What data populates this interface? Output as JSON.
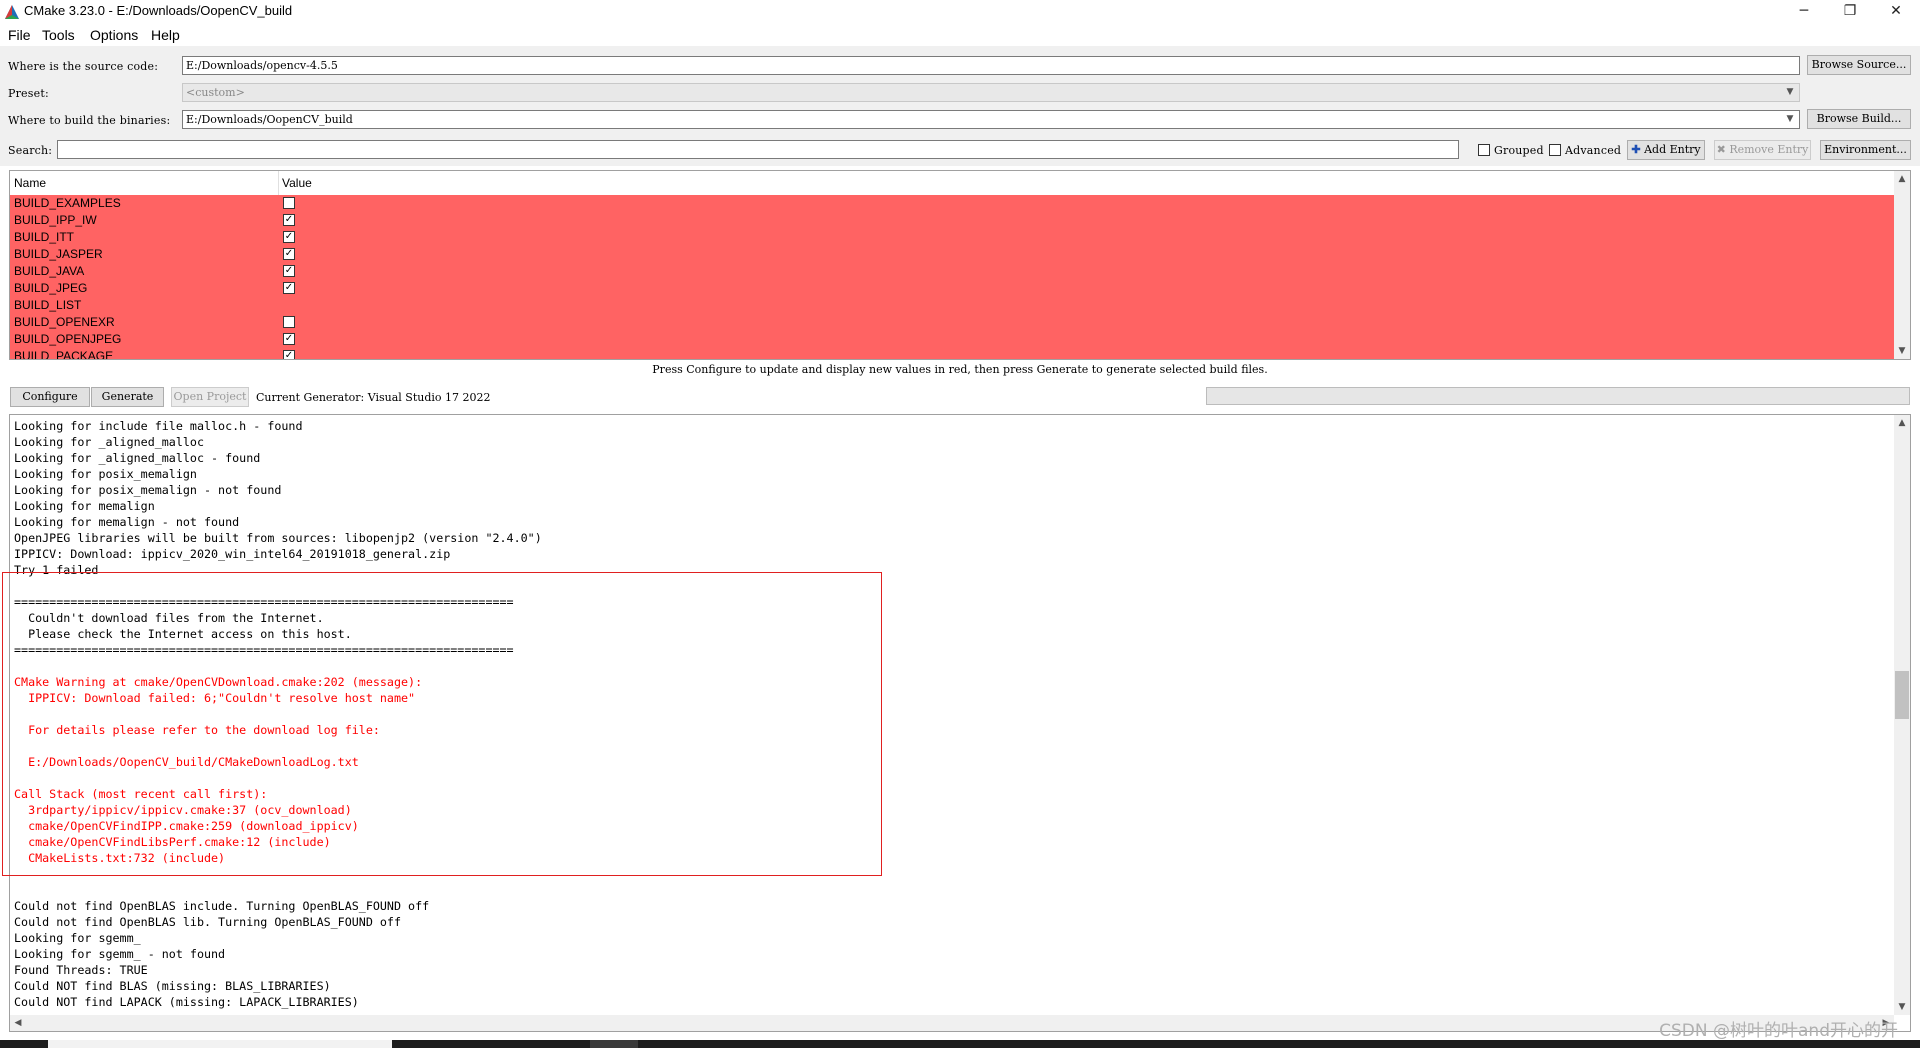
{
  "window": {
    "title": "CMake 3.23.0 - E:/Downloads/OopenCV_build",
    "minimize": "─",
    "restore": "❐",
    "close": "✕"
  },
  "menu": {
    "file": "File",
    "tools": "Tools",
    "options": "Options",
    "help": "Help"
  },
  "form": {
    "source_label": "Where is the source code:",
    "source_value": "E:/Downloads/opencv-4.5.5",
    "browse_source": "Browse Source...",
    "preset_label": "Preset:",
    "preset_value": "<custom>",
    "build_label": "Where to build the binaries:",
    "build_value": "E:/Downloads/OopenCV_build",
    "browse_build": "Browse Build...",
    "search_label": "Search:",
    "search_value": "",
    "grouped": "Grouped",
    "advanced": "Advanced",
    "add_entry": "Add Entry",
    "remove_entry": "Remove Entry",
    "environment": "Environment..."
  },
  "table": {
    "col_name": "Name",
    "col_value": "Value",
    "rows": [
      {
        "name": "BUILD_EXAMPLES",
        "checked": false,
        "has_box": true
      },
      {
        "name": "BUILD_IPP_IW",
        "checked": true,
        "has_box": true
      },
      {
        "name": "BUILD_ITT",
        "checked": true,
        "has_box": true
      },
      {
        "name": "BUILD_JASPER",
        "checked": true,
        "has_box": true
      },
      {
        "name": "BUILD_JAVA",
        "checked": true,
        "has_box": true
      },
      {
        "name": "BUILD_JPEG",
        "checked": true,
        "has_box": true
      },
      {
        "name": "BUILD_LIST",
        "checked": false,
        "has_box": false
      },
      {
        "name": "BUILD_OPENEXR",
        "checked": false,
        "has_box": true
      },
      {
        "name": "BUILD_OPENJPEG",
        "checked": true,
        "has_box": true
      },
      {
        "name": "BUILD_PACKAGE",
        "checked": true,
        "has_box": true
      }
    ],
    "row_color": "#ff6363"
  },
  "hint": "Press Configure to update and display new values in red, then press Generate to generate selected build files.",
  "actions": {
    "configure": "Configure",
    "generate": "Generate",
    "open_project": "Open Project",
    "generator": "Current Generator: Visual Studio 17 2022"
  },
  "log": [
    {
      "text": "Looking for include file malloc.h - found",
      "warn": false
    },
    {
      "text": "Looking for _aligned_malloc",
      "warn": false
    },
    {
      "text": "Looking for _aligned_malloc - found",
      "warn": false
    },
    {
      "text": "Looking for posix_memalign",
      "warn": false
    },
    {
      "text": "Looking for posix_memalign - not found",
      "warn": false
    },
    {
      "text": "Looking for memalign",
      "warn": false
    },
    {
      "text": "Looking for memalign - not found",
      "warn": false
    },
    {
      "text": "OpenJPEG libraries will be built from sources: libopenjp2 (version \"2.4.0\")",
      "warn": false
    },
    {
      "text": "IPPICV: Download: ippicv_2020_win_intel64_20191018_general.zip",
      "warn": false
    },
    {
      "text": "Try 1 failed",
      "warn": false
    },
    {
      "text": "",
      "warn": false
    },
    {
      "text": "=======================================================================",
      "warn": false
    },
    {
      "text": "  Couldn't download files from the Internet.",
      "warn": false
    },
    {
      "text": "  Please check the Internet access on this host.",
      "warn": false
    },
    {
      "text": "=======================================================================",
      "warn": false
    },
    {
      "text": "",
      "warn": false
    },
    {
      "text": "CMake Warning at cmake/OpenCVDownload.cmake:202 (message):",
      "warn": true
    },
    {
      "text": "  IPPICV: Download failed: 6;\"Couldn't resolve host name\"",
      "warn": true
    },
    {
      "text": "",
      "warn": true
    },
    {
      "text": "  For details please refer to the download log file:",
      "warn": true
    },
    {
      "text": "",
      "warn": true
    },
    {
      "text": "  E:/Downloads/OopenCV_build/CMakeDownloadLog.txt",
      "warn": true
    },
    {
      "text": "",
      "warn": true
    },
    {
      "text": "Call Stack (most recent call first):",
      "warn": true
    },
    {
      "text": "  3rdparty/ippicv/ippicv.cmake:37 (ocv_download)",
      "warn": true
    },
    {
      "text": "  cmake/OpenCVFindIPP.cmake:259 (download_ippicv)",
      "warn": true
    },
    {
      "text": "  cmake/OpenCVFindLibsPerf.cmake:12 (include)",
      "warn": true
    },
    {
      "text": "  CMakeLists.txt:732 (include)",
      "warn": true
    },
    {
      "text": "",
      "warn": false
    },
    {
      "text": "",
      "warn": false
    },
    {
      "text": "Could not find OpenBLAS include. Turning OpenBLAS_FOUND off",
      "warn": false
    },
    {
      "text": "Could not find OpenBLAS lib. Turning OpenBLAS_FOUND off",
      "warn": false
    },
    {
      "text": "Looking for sgemm_",
      "warn": false
    },
    {
      "text": "Looking for sgemm_ - not found",
      "warn": false
    },
    {
      "text": "Found Threads: TRUE",
      "warn": false
    },
    {
      "text": "Could NOT find BLAS (missing: BLAS_LIBRARIES)",
      "warn": false
    },
    {
      "text": "Could NOT find LAPACK (missing: LAPACK_LIBRARIES)",
      "warn": false
    }
  ],
  "watermark": "CSDN @树叶的叶and开心的开",
  "colors": {
    "warning_text": "#ff0000",
    "highlight_border": "#e02020",
    "changed_row": "#ff6363"
  }
}
